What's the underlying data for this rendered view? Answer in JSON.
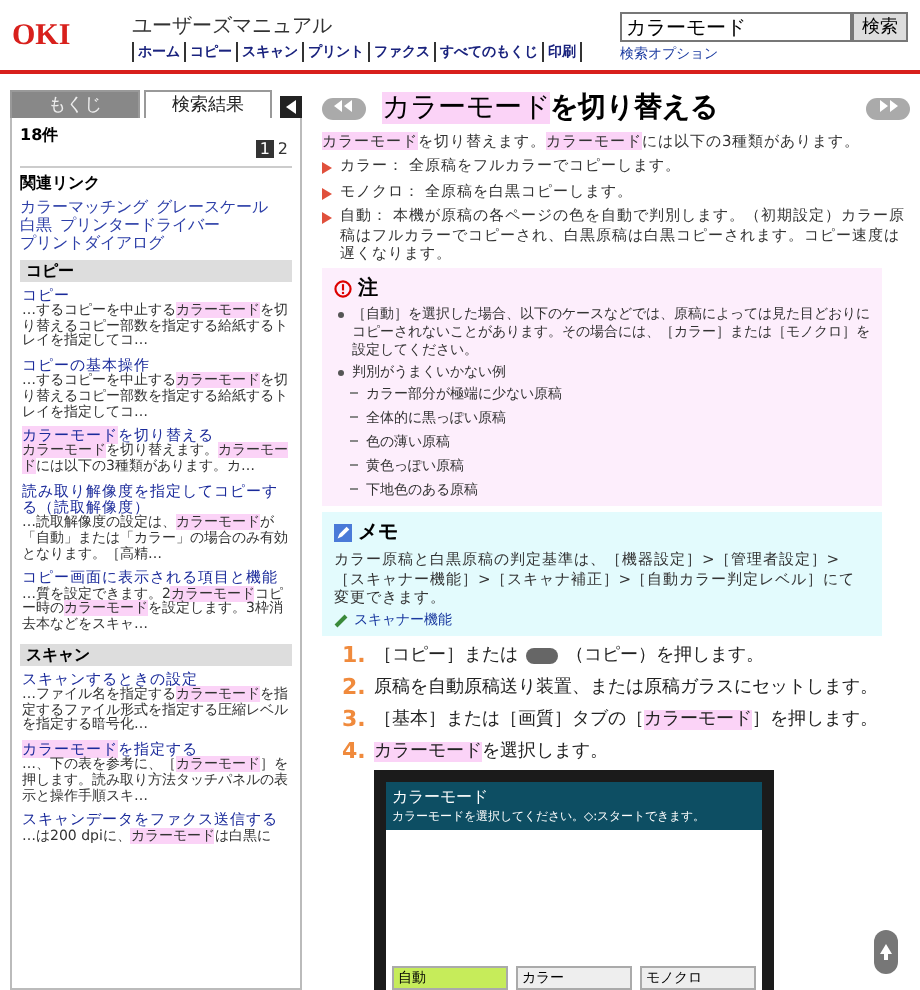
{
  "header": {
    "logo": "OKI",
    "title": "ユーザーズマニュアル",
    "nav": [
      "ホーム",
      "コピー",
      "スキャン",
      "プリント",
      "ファクス",
      "すべてのもくじ",
      "印刷"
    ],
    "search": {
      "value": "カラーモード",
      "button": "検索",
      "option_link": "検索オプション"
    }
  },
  "sidebar": {
    "tabs": [
      {
        "label": "もくじ",
        "selected": false
      },
      {
        "label": "検索結果",
        "selected": true
      }
    ],
    "count": "18件",
    "pages": [
      {
        "label": "1",
        "selected": true
      },
      {
        "label": "2",
        "selected": false
      }
    ],
    "related": {
      "heading": "関連リンク",
      "links": [
        "カラーマッチング",
        "グレースケール",
        "白黒",
        "プリンタードライバー",
        "プリントダイアログ"
      ]
    },
    "sections": [
      {
        "heading": "コピー",
        "results": [
          {
            "title": "コピー",
            "snippet": "…するコピーを中止する**カラーモード**を切り替えるコピー部数を指定する給紙するトレイを指定してコ…"
          },
          {
            "title": "コピーの基本操作",
            "snippet": "…するコピーを中止する**カラーモード**を切り替えるコピー部数を指定する給紙するトレイを指定してコ…"
          },
          {
            "title": "**カラーモード**を切り替える",
            "snippet": "**カラーモード**を切り替えます。**カラーモード**には以下の3種類があります。カ…"
          },
          {
            "title": "読み取り解像度を指定してコピーする（読取解像度）",
            "snippet": "…読取解像度の設定は、**カラーモード**が「自動」または「カラー」の場合のみ有効となります。［高精…"
          },
          {
            "title": "コピー画面に表示される項目と機能",
            "snippet": "…質を設定できます。2**カラーモード**コピー時の**カラーモード**を設定します。3枠消去本などをスキャ…"
          }
        ]
      },
      {
        "heading": "スキャン",
        "results": [
          {
            "title": "スキャンするときの設定",
            "snippet": "…ファイル名を指定する**カラーモード**を指定するファイル形式を指定する圧縮レベルを指定する暗号化…"
          },
          {
            "title": "**カラーモード**を指定する",
            "snippet": "…、下の表を参考に、［**カラーモード**］を押します。読み取り方法タッチパネルの表示と操作手順スキ…"
          },
          {
            "title": "スキャンデータをファクス送信する",
            "snippet": "…は200 dpiに、**カラーモード**は白黒に"
          }
        ]
      }
    ]
  },
  "main": {
    "title": "**カラーモード**を切り替える",
    "intro": "**カラーモード**を切り替えます。**カラーモード**には以下の3種類があります。",
    "modes": [
      {
        "label": "カラー：",
        "text": "全原稿をフルカラーでコピーします。"
      },
      {
        "label": "モノクロ：",
        "text": "全原稿を白黒コピーします。"
      },
      {
        "label": "自動：",
        "text": "本機が原稿の各ページの色を自動で判別します。（初期設定）カラー原稿はフルカラーでコピーされ、白黒原稿は白黒コピーされます。コピー速度は遅くなります。"
      }
    ],
    "note": {
      "title": "注",
      "items": [
        {
          "text": "［自動］を選択した場合、以下のケースなどでは、原稿によっては見た目どおりにコピーされないことがあります。その場合には、［カラー］または［モノクロ］を設定してください。"
        },
        {
          "text": "判別がうまくいかない例",
          "subitems": [
            "カラー部分が極端に少ない原稿",
            "全体的に黒っぽい原稿",
            "色の薄い原稿",
            "黄色っぽい原稿",
            "下地色のある原稿"
          ]
        }
      ]
    },
    "memo": {
      "title": "メモ",
      "text": "カラー原稿と白黒原稿の判定基準は、［機器設定］>［管理者設定］>［スキャナー機能］>［スキャナ補正］>［自動カラー判定レベル］にて変更できます。",
      "link": "スキャナー機能"
    },
    "steps": [
      {
        "number": "1.",
        "before": "［コピー］または",
        "icon": true,
        "after": "（コピー）を押します。"
      },
      {
        "number": "2.",
        "before": "原稿を自動原稿送り装置、または原稿ガラスにセットします。",
        "icon": false
      },
      {
        "number": "3.",
        "before": "［基本］または［画質］タブの［**カラーモード**］を押します。",
        "icon": false
      },
      {
        "number": "4.",
        "before": "**カラーモード**を選択します。",
        "icon": false
      }
    ],
    "panel": {
      "title": "カラーモード",
      "subtitle": "カラーモードを選択してください。◇:スタートできます。",
      "options": [
        {
          "label": "自動",
          "selected": true
        },
        {
          "label": "カラー",
          "selected": false
        },
        {
          "label": "モノクロ",
          "selected": false
        }
      ]
    }
  }
}
